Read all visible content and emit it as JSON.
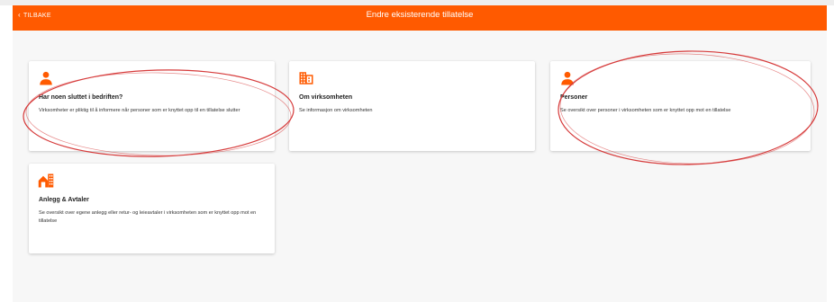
{
  "header": {
    "back_label": "TILBAKE",
    "title": "Endre eksisterende tillatelse",
    "color": "#ff5a00"
  },
  "cards": [
    {
      "icon": "person-icon",
      "title": "Har noen sluttet i bedriften?",
      "description": "Virksomheter er pliktig til å informere når personer som er knyttet opp til en tillatelse slutter"
    },
    {
      "icon": "building-icon",
      "title": "Om virksomheten",
      "description": "Se informasjon om virksomheten"
    },
    {
      "icon": "person-icon",
      "title": "Personer",
      "description": "Se oversikt over personer i virksomheten som er knyttet opp mot en tillatelse"
    },
    {
      "icon": "home-building-icon",
      "title": "Anlegg & Avtaler",
      "description": "Se oversikt over egene anlegg eller retur- og leieavtaler i virksomheten som er knyttet opp mot en tillatelse"
    }
  ],
  "annotation_color": "#d63a3a"
}
